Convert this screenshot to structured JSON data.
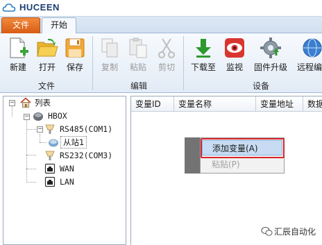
{
  "app": {
    "title": "HUCEEN"
  },
  "tabs": {
    "file": "文件",
    "start": "开始"
  },
  "ribbon": {
    "groups": {
      "file": {
        "label": "文件",
        "buttons": {
          "new": "新建",
          "open": "打开",
          "save": "保存"
        }
      },
      "edit": {
        "label": "编辑",
        "buttons": {
          "copy": "复制",
          "paste": "粘贴",
          "cut": "剪切"
        }
      },
      "device": {
        "label": "设备",
        "buttons": {
          "download": "下载至",
          "monitor": "监视",
          "firmware": "固件升级",
          "remote": "远程编"
        }
      }
    }
  },
  "tree": {
    "root": "列表",
    "hbox": "HBOX",
    "rs485": "RS485(COM1)",
    "slave": "从站1",
    "rs232": "RS232(COM3)",
    "wan": "WAN",
    "lan": "LAN"
  },
  "grid": {
    "columns": [
      "变量ID",
      "变量名称",
      "变量地址",
      "数据"
    ]
  },
  "context_menu": {
    "items": [
      "添加变量(A)",
      "粘贴(P)"
    ],
    "highlight_color": "#d8262d"
  },
  "watermark": {
    "text": "汇辰自动化"
  },
  "colors": {
    "file_tab": "#e06b22",
    "brand": "#1b3f73"
  }
}
